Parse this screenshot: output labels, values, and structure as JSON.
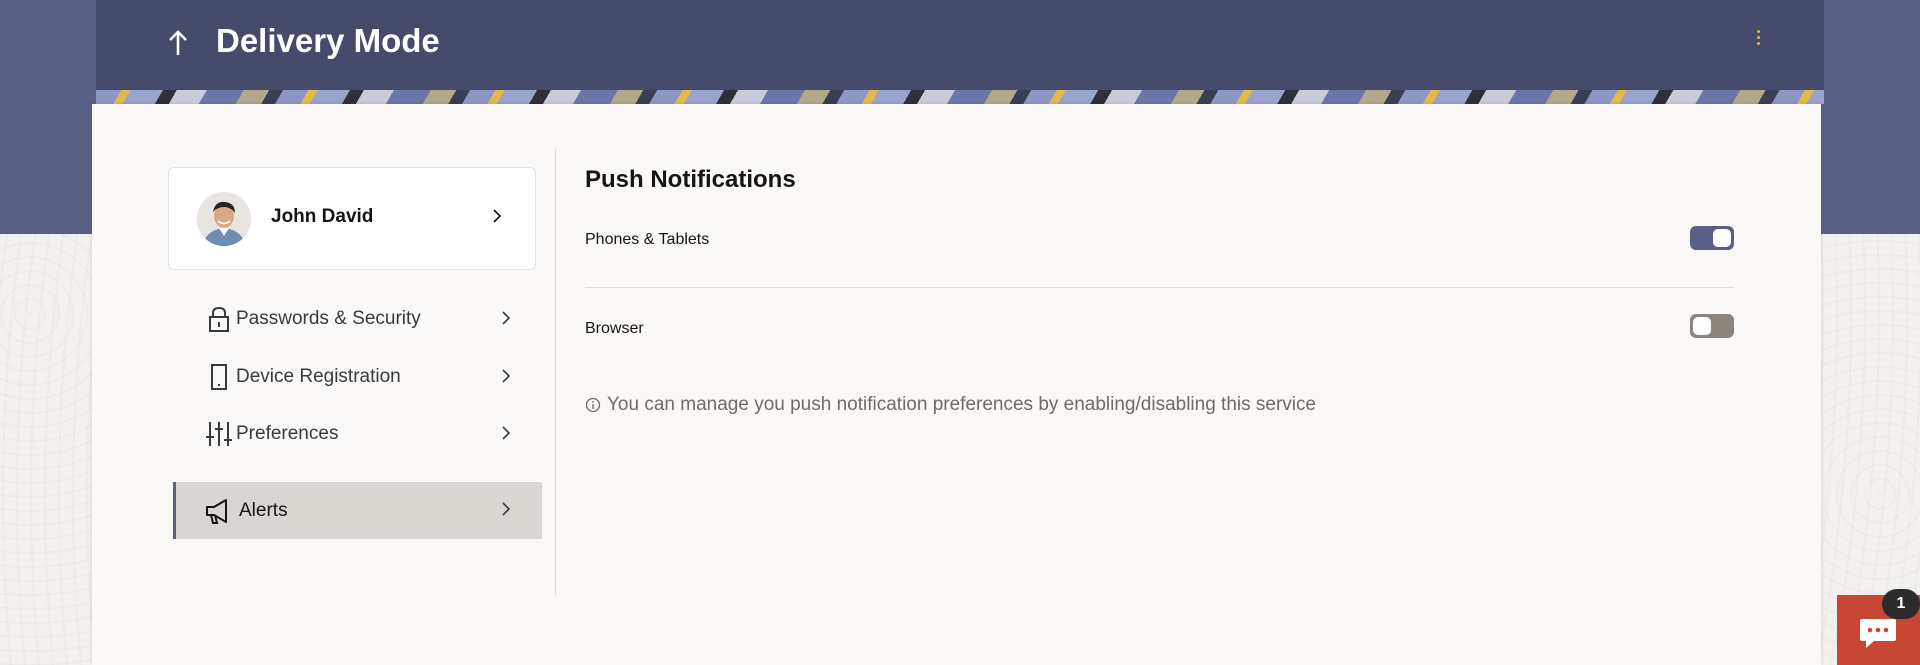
{
  "header": {
    "title": "Delivery Mode",
    "back_icon": "arrow-up-icon",
    "menu_icon": "kebab-menu-icon"
  },
  "profile": {
    "name": "John David"
  },
  "nav": {
    "items": [
      {
        "label": "Passwords & Security",
        "icon": "lock-icon"
      },
      {
        "label": "Device Registration",
        "icon": "phone-icon"
      },
      {
        "label": "Preferences",
        "icon": "sliders-icon"
      },
      {
        "label": "Alerts",
        "icon": "megaphone-icon",
        "active": true
      }
    ]
  },
  "push": {
    "title": "Push Notifications",
    "settings": [
      {
        "label": "Phones & Tablets",
        "enabled": true
      },
      {
        "label": "Browser",
        "enabled": false
      }
    ],
    "info": "You can manage you push notification preferences by enabling/disabling this service"
  },
  "chat": {
    "badge": "1",
    "icon": "chat-icon"
  },
  "colors": {
    "brand": "#474b6b",
    "toggle_on": "#5a5f86",
    "toggle_off": "#8b857e",
    "chat": "#c74634",
    "accent": "#e3b94a"
  }
}
